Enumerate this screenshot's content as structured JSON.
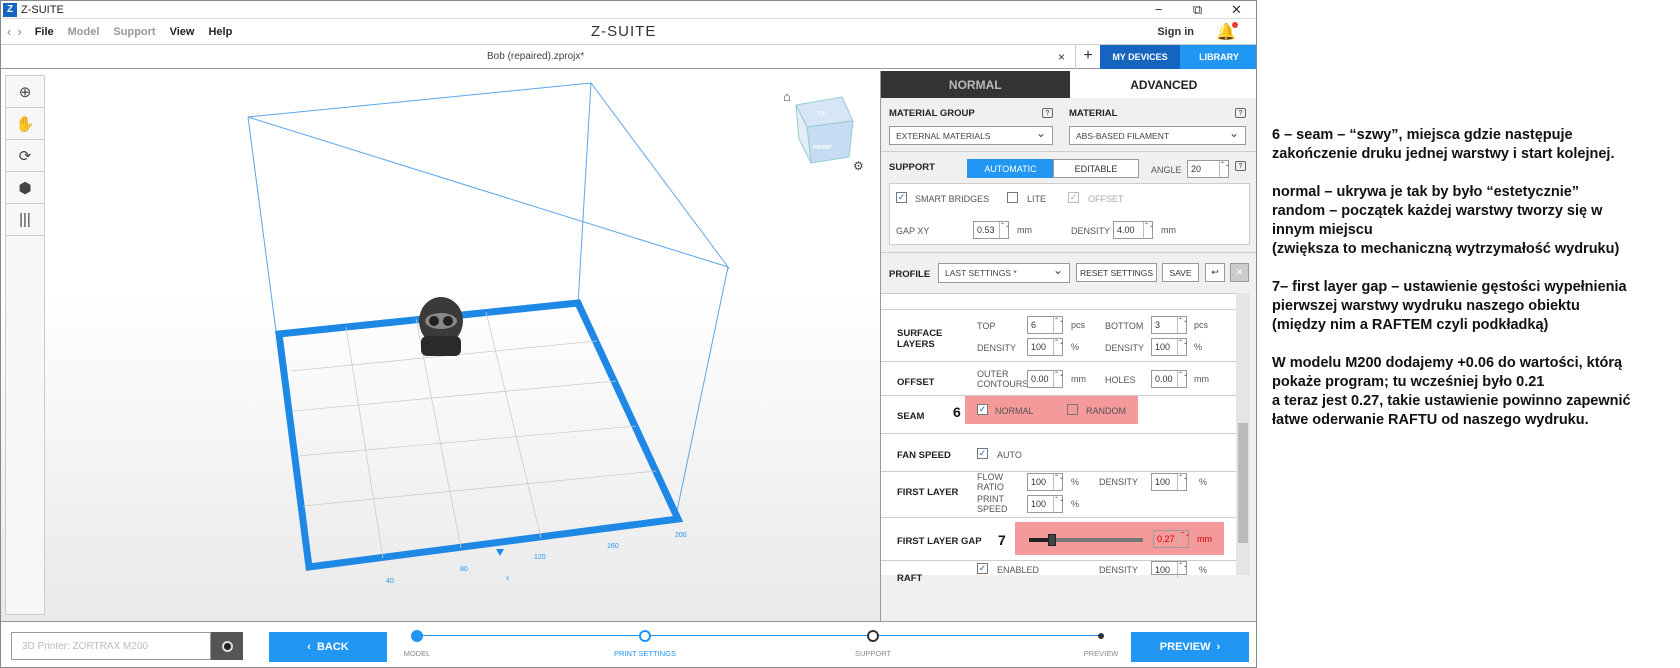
{
  "titlebar": {
    "logo": "Z",
    "title": "Z-SUITE",
    "minimize": "−",
    "restore": "⧉",
    "close": "✕"
  },
  "menu": {
    "items": [
      "File",
      "Model",
      "Support",
      "View",
      "Help"
    ],
    "app_name": "Z-SUITE",
    "sign_in": "Sign in"
  },
  "tabs": {
    "file_name": "Bob (repaired).zprojx*",
    "close": "×",
    "add": "+",
    "my_devices": "MY DEVICES",
    "library": "LIBRARY"
  },
  "viewport": {
    "home_icon": "⌂",
    "cube_top": "TOP",
    "cube_front": "FRONT",
    "axis_ticks": [
      "40",
      "80",
      "120",
      "160",
      "200"
    ],
    "axis_x": "x"
  },
  "panel": {
    "mode_tabs": [
      "NORMAL",
      "ADVANCED"
    ],
    "material_group": {
      "label": "MATERIAL GROUP",
      "value": "EXTERNAL MATERIALS"
    },
    "material": {
      "label": "MATERIAL",
      "value": "ABS-BASED FILAMENT"
    },
    "support": {
      "label": "SUPPORT",
      "automatic": "AUTOMATIC",
      "editable": "EDITABLE",
      "angle_label": "ANGLE",
      "angle": "20",
      "smart_bridges": "SMART BRIDGES",
      "lite": "LITE",
      "offset": "OFFSET",
      "gap_xy_label": "GAP XY",
      "gap_xy": "0.53",
      "density_label": "DENSITY",
      "density": "4.00",
      "unit": "mm"
    },
    "profile": {
      "label": "PROFILE",
      "value": "LAST SETTINGS *",
      "reset": "RESET SETTINGS",
      "save": "SAVE"
    },
    "surface": {
      "label_1": "SURFACE",
      "label_2": "LAYERS",
      "top": "TOP",
      "top_val": "6",
      "bottom": "BOTTOM",
      "bottom_val": "3",
      "pcs": "pcs",
      "density": "DENSITY",
      "density_top": "100",
      "density_bottom": "100",
      "pct": "%"
    },
    "offset": {
      "label": "OFFSET",
      "outer_1": "OUTER",
      "outer_2": "CONTOURS",
      "outer_val": "0.00",
      "holes": "HOLES",
      "holes_val": "0.00",
      "unit": "mm"
    },
    "seam": {
      "label": "SEAM",
      "marker": "6",
      "normal": "NORMAL",
      "random": "RANDOM"
    },
    "fan": {
      "label": "FAN SPEED",
      "auto": "AUTO"
    },
    "first_layer": {
      "label": "FIRST LAYER",
      "flow_1": "FLOW",
      "flow_2": "RATIO",
      "flow_val": "100",
      "print_1": "PRINT",
      "print_2": "SPEED",
      "print_val": "100",
      "density": "DENSITY",
      "density_val": "100",
      "pct": "%"
    },
    "first_layer_gap": {
      "label": "FIRST LAYER GAP",
      "marker": "7",
      "value": "0.27",
      "unit": "mm",
      "slider_fraction": 0.2
    },
    "raft": {
      "label": "RAFT",
      "enabled": "ENABLED",
      "density": "DENSITY",
      "density_val": "100",
      "pct": "%"
    }
  },
  "bottom": {
    "printer_placeholder": "3D Printer: ZORTRAX M200",
    "back": "BACK",
    "preview": "PREVIEW",
    "steps": [
      "MODEL",
      "PRINT SETTINGS",
      "SUPPORT",
      "PREVIEW"
    ]
  },
  "notes": {
    "p1": [
      "6 – seam – “szwy”, miejsca gdzie następuje",
      "zakończenie druku jednej warstwy i start kolejnej."
    ],
    "p2": [
      "normal – ukrywa je tak by było “estetycznie”",
      "random – początek każdej warstwy tworzy się w",
      "innym miejscu",
      "(zwiększa to mechaniczną wytrzymałość wydruku)"
    ],
    "p3": [
      "7– first layer gap – ustawienie gęstości wypełnienia",
      "pierwszej warstwy wydruku naszego obiektu",
      "(między nim a RAFTEM czyli podkładką)"
    ],
    "p4": [
      "W modelu M200 dodajemy +0.06 do wartości, którą",
      "pokaże program; tu wcześniej było 0.21",
      "a teraz jest 0.27, takie ustawienie powinno zapewnić",
      "łatwe oderwanie RAFTU od naszego wydruku."
    ]
  }
}
